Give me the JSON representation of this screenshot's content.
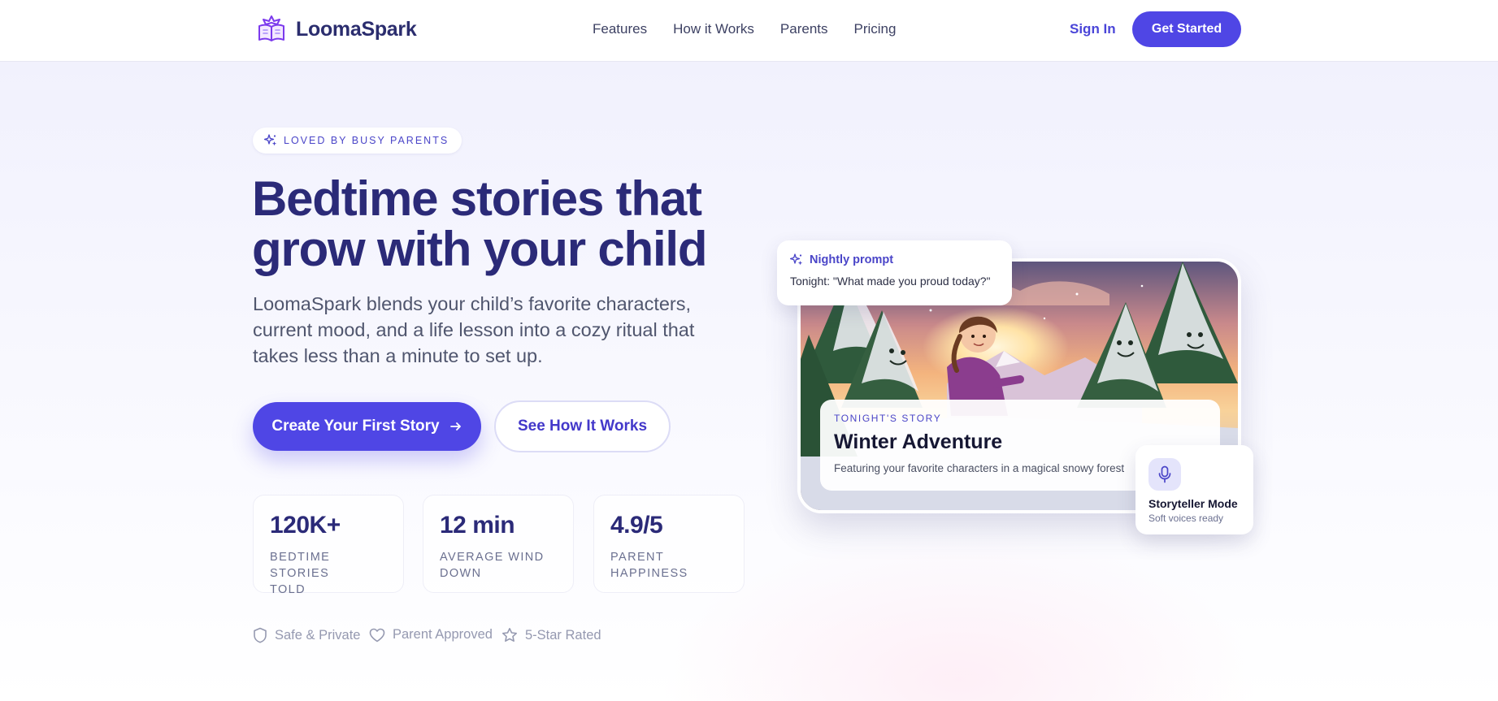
{
  "brand": {
    "name": "LoomaSpark"
  },
  "nav": {
    "links": [
      "Features",
      "How it Works",
      "Parents",
      "Pricing"
    ],
    "sign_in": "Sign In",
    "get_started": "Get Started"
  },
  "hero": {
    "badge": "LOVED BY BUSY PARENTS",
    "title_line1": "Bedtime stories that",
    "title_line2": "grow with your child",
    "subtitle_line1": "LoomaSpark blends your child’s favorite characters,",
    "subtitle_line2": "current mood, and a life lesson into a cozy ritual that",
    "subtitle_line3": "takes less than a minute to set up.",
    "cta_primary": "Create Your First Story",
    "cta_secondary": "See How It Works"
  },
  "stats": [
    {
      "value": "120K+",
      "label_line1": "BEDTIME STORIES",
      "label_line2": "TOLD"
    },
    {
      "value": "12 min",
      "label_line1": "AVERAGE WIND",
      "label_line2": "DOWN"
    },
    {
      "value": "4.9/5",
      "label_line1": "PARENT",
      "label_line2": "HAPPINESS"
    }
  ],
  "trust": [
    "Safe & Private",
    "Parent Approved",
    "5-Star Rated"
  ],
  "prompt_card": {
    "heading": "Nightly prompt",
    "text": "Tonight: \"What made you proud today?\""
  },
  "story_card": {
    "tag": "TONIGHT'S STORY",
    "title": "Winter Adventure",
    "description": "Featuring your favorite characters in a magical snowy forest"
  },
  "voice_card": {
    "title": "Storyteller Mode",
    "subtitle": "Soft voices ready"
  },
  "colors": {
    "primary": "#4f46e5",
    "heading": "#2b2a78",
    "accent_text": "#4a45c8"
  },
  "icons": {
    "logo": "storybook-crown-icon",
    "badge": "sparkles-icon",
    "cta_arrow": "arrow-right-icon",
    "trust": [
      "shield-icon",
      "heart-icon",
      "star-icon"
    ],
    "prompt": "sparkles-icon",
    "voice": "microphone-icon"
  }
}
